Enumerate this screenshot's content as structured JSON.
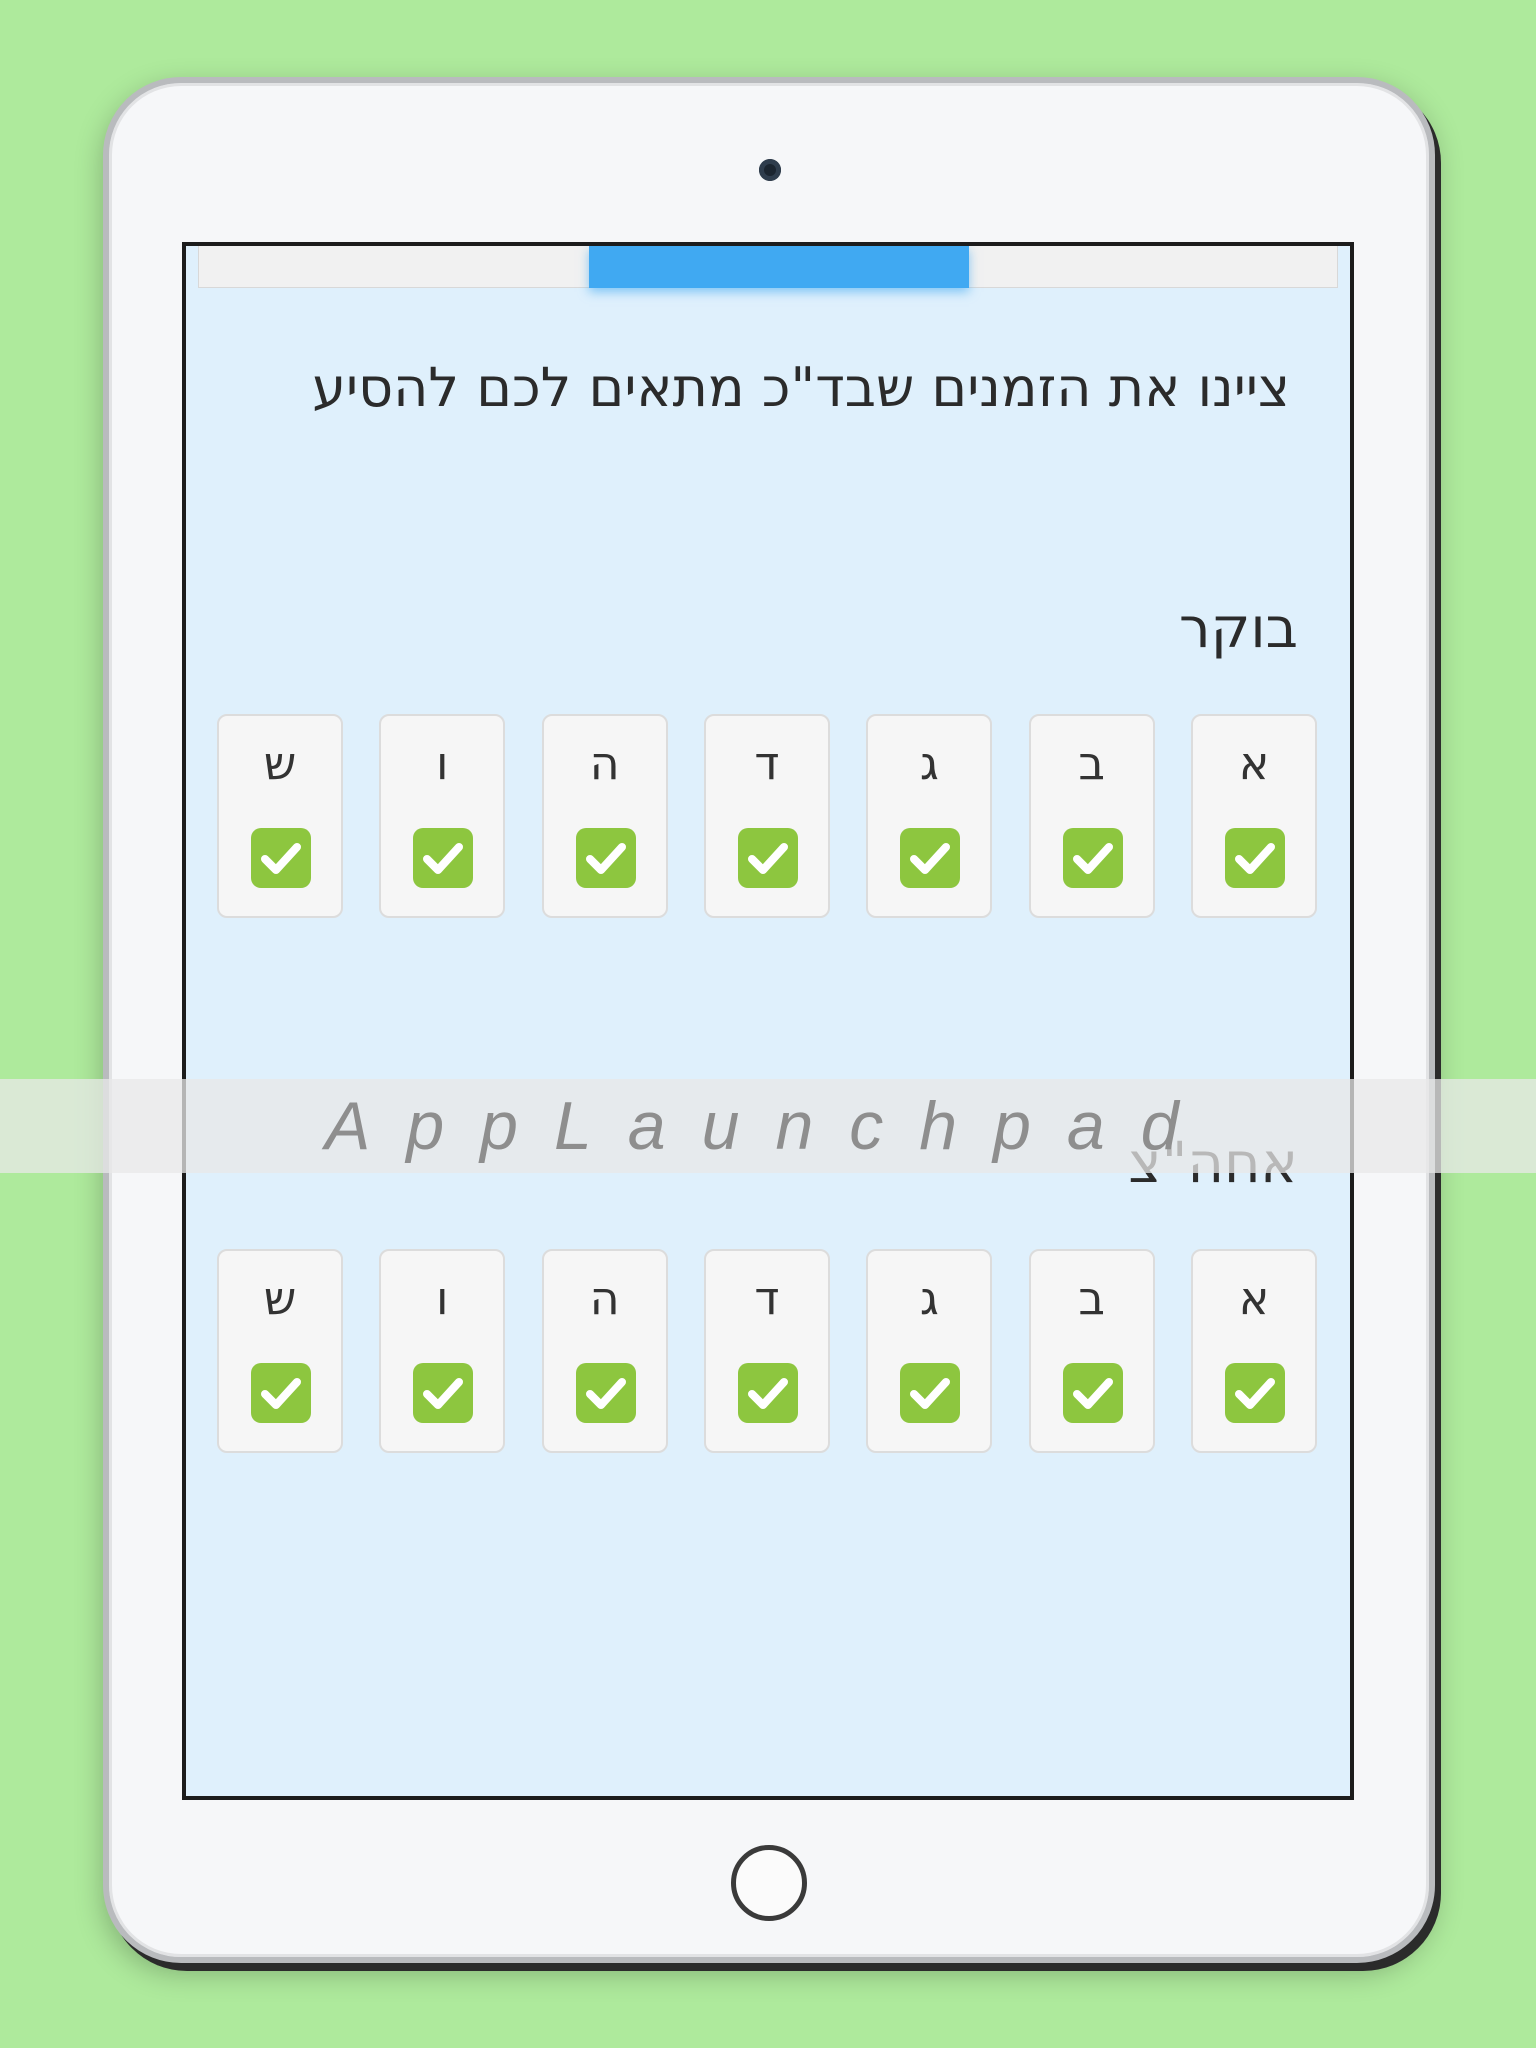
{
  "progress": {
    "fraction": 0.33
  },
  "page": {
    "title": "ציינו את הזמנים שבד\"כ מתאים לכם להסיע"
  },
  "sections": [
    {
      "title": "בוקר",
      "days": [
        {
          "label": "א",
          "checked": true
        },
        {
          "label": "ב",
          "checked": true
        },
        {
          "label": "ג",
          "checked": true
        },
        {
          "label": "ד",
          "checked": true
        },
        {
          "label": "ה",
          "checked": true
        },
        {
          "label": "ו",
          "checked": true
        },
        {
          "label": "ש",
          "checked": true
        }
      ]
    },
    {
      "title": "אחה\"צ",
      "days": [
        {
          "label": "א",
          "checked": true
        },
        {
          "label": "ב",
          "checked": true
        },
        {
          "label": "ג",
          "checked": true
        },
        {
          "label": "ד",
          "checked": true
        },
        {
          "label": "ה",
          "checked": true
        },
        {
          "label": "ו",
          "checked": true
        },
        {
          "label": "ש",
          "checked": true
        }
      ]
    }
  ],
  "watermark": {
    "text": "AppLaunchpad"
  },
  "colors": {
    "accent": "#40a9f2",
    "check": "#8dc63f",
    "background": "#aeea9c"
  }
}
